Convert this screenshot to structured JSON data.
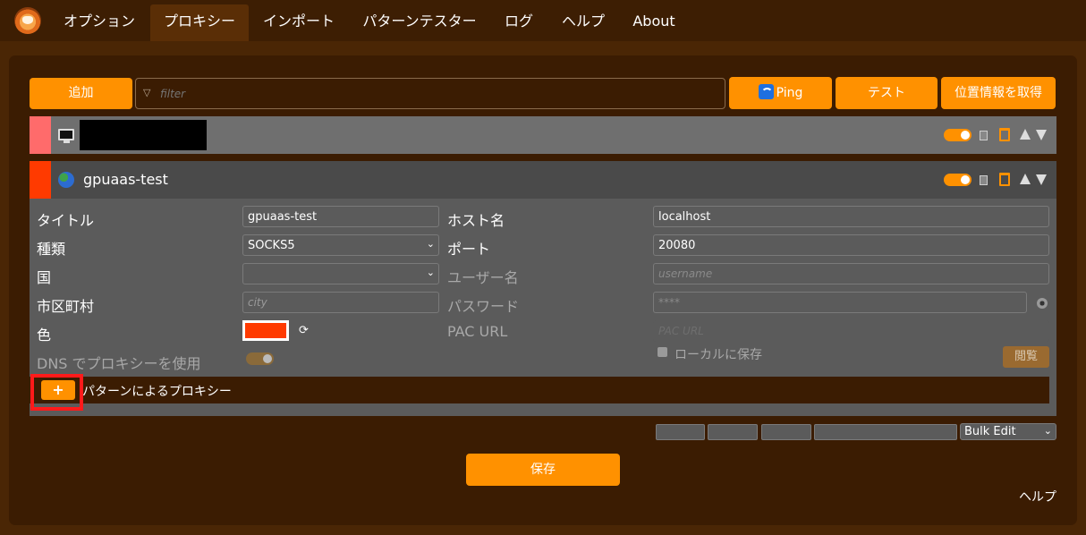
{
  "nav": {
    "tabs": [
      {
        "label": "オプション"
      },
      {
        "label": "プロキシー"
      },
      {
        "label": "インポート"
      },
      {
        "label": "パターンテスター"
      },
      {
        "label": "ログ"
      },
      {
        "label": "ヘルプ"
      },
      {
        "label": "About"
      }
    ],
    "active_tab": "プロキシー"
  },
  "toolbar": {
    "add_label": "追加",
    "filter_placeholder": "filter",
    "ping_label": "Ping",
    "test_label": "テスト",
    "geo_label": "位置情報を取得"
  },
  "proxies": [
    {
      "title": "",
      "color": "#ff6b6b",
      "enabled": true,
      "icon": "monitor-icon"
    },
    {
      "title": "gpuaas-test",
      "color": "#ff3a00",
      "enabled": true,
      "icon": "globe-icon"
    }
  ],
  "details": {
    "title_label": "タイトル",
    "title_value": "gpuaas-test",
    "type_label": "種類",
    "type_value": "SOCKS5",
    "country_label": "国",
    "country_value": "",
    "city_label": "市区町村",
    "city_placeholder": "city",
    "color_label": "色",
    "color_value": "#ff3a00",
    "dns_label": "DNS でプロキシーを使用",
    "host_label": "ホスト名",
    "host_value": "localhost",
    "port_label": "ポート",
    "port_value": "20080",
    "username_label": "ユーザー名",
    "username_placeholder": "username",
    "password_label": "パスワード",
    "password_placeholder": "****",
    "pac_label": "PAC URL",
    "pac_placeholder": "PAC URL",
    "store_local_label": "ローカルに保存",
    "view_label": "閲覧",
    "pattern_label": "パターンによるプロキシー"
  },
  "bulk_edit": {
    "selected": "Bulk Edit"
  },
  "footer": {
    "save_label": "保存",
    "help_label": "ヘルプ"
  },
  "colors": {
    "accent": "#ff9100",
    "background": "#4a2605",
    "panel": "#3b1c02"
  }
}
